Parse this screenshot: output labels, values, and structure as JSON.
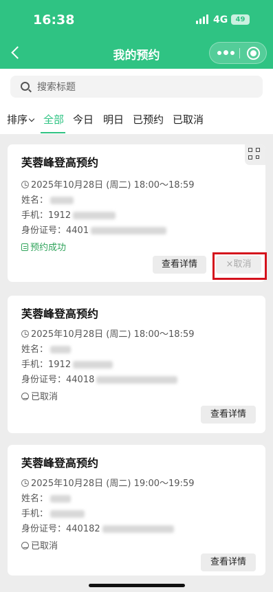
{
  "status_bar": {
    "time": "16:38",
    "network": "4G",
    "battery": "49"
  },
  "nav": {
    "title": "我的预约",
    "back_icon": "chevron-left-icon",
    "more_icon": "more-dots-icon",
    "close_icon": "target-icon"
  },
  "search": {
    "placeholder": "搜索标题"
  },
  "tabs": {
    "sort_label": "排序",
    "items": [
      {
        "label": "全部",
        "active": true
      },
      {
        "label": "今日"
      },
      {
        "label": "明日"
      },
      {
        "label": "已预约"
      },
      {
        "label": "已取消"
      }
    ]
  },
  "cards": [
    {
      "title": "芙蓉峰登高预约",
      "time": "2025年10月28日 (周二) 18:00～18:59",
      "name_label": "姓名：",
      "name_value": "",
      "phone_label": "手机：",
      "phone_value": "1912",
      "id_label": "身份证号：",
      "id_value": "4401",
      "status": "预约成功",
      "detail_btn": "查看详情",
      "cancel_btn": "×取消",
      "qr_icon": "qr-code-icon"
    },
    {
      "title": "芙蓉峰登高预约",
      "time": "2025年10月28日 (周二) 18:00～18:59",
      "name_label": "姓名：",
      "name_value": "",
      "phone_label": "手机：",
      "phone_value": "1912",
      "id_label": "身份证号：",
      "id_value": "44018",
      "status": "已取消",
      "detail_btn": "查看详情"
    },
    {
      "title": "芙蓉峰登高预约",
      "time": "2025年10月28日 (周二) 19:00～19:59",
      "name_label": "姓名：",
      "name_value": "",
      "phone_label": "手机：",
      "phone_value": "",
      "id_label": "身份证号：",
      "id_value": "440182",
      "status": "已取消",
      "detail_btn": "查看详情"
    }
  ],
  "colors": {
    "brand": "#2fc383",
    "success": "#2fa35a",
    "highlight": "#d4111c"
  }
}
